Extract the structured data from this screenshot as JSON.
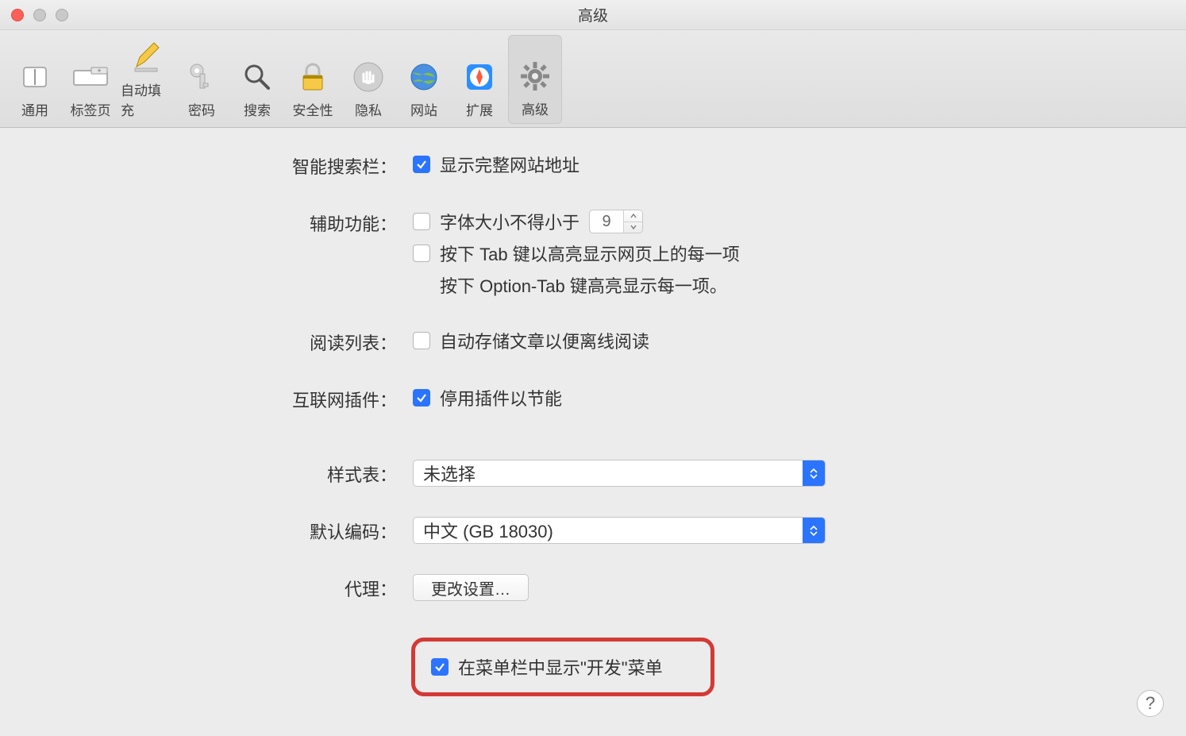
{
  "window": {
    "title": "高级"
  },
  "toolbar": {
    "items": [
      {
        "label": "通用"
      },
      {
        "label": "标签页"
      },
      {
        "label": "自动填充"
      },
      {
        "label": "密码"
      },
      {
        "label": "搜索"
      },
      {
        "label": "安全性"
      },
      {
        "label": "隐私"
      },
      {
        "label": "网站"
      },
      {
        "label": "扩展"
      },
      {
        "label": "高级"
      }
    ]
  },
  "sections": {
    "smart_search": {
      "label": "智能搜索栏：",
      "show_full_address": {
        "checked": true,
        "text": "显示完整网站地址"
      }
    },
    "accessibility": {
      "label": "辅助功能：",
      "min_font": {
        "checked": false,
        "text": "字体大小不得小于",
        "value": "9"
      },
      "tab_highlight": {
        "checked": false,
        "text": "按下 Tab 键以高亮显示网页上的每一项"
      },
      "option_tab_note": "按下 Option-Tab 键高亮显示每一项。"
    },
    "reading_list": {
      "label": "阅读列表：",
      "save_offline": {
        "checked": false,
        "text": "自动存储文章以便离线阅读"
      }
    },
    "plugins": {
      "label": "互联网插件：",
      "stop_plugins": {
        "checked": true,
        "text": "停用插件以节能"
      }
    },
    "stylesheet": {
      "label": "样式表：",
      "value": "未选择"
    },
    "encoding": {
      "label": "默认编码：",
      "value": "中文 (GB 18030)"
    },
    "proxy": {
      "label": "代理：",
      "button": "更改设置…"
    },
    "dev_menu": {
      "checked": true,
      "text": "在菜单栏中显示\"开发\"菜单"
    }
  },
  "help_glyph": "?"
}
